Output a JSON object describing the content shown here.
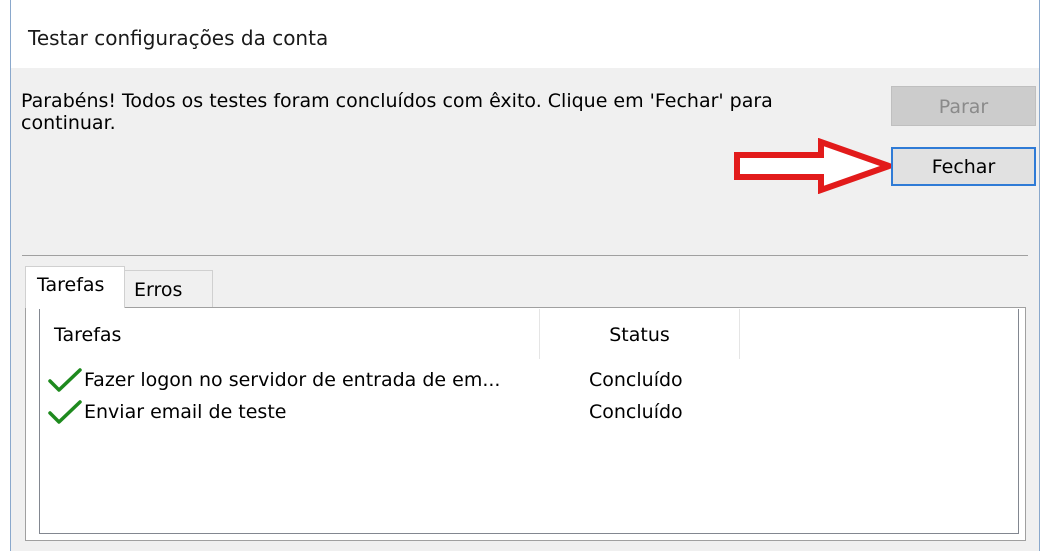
{
  "window": {
    "title": "Testar configurações da conta"
  },
  "message": "Parabéns! Todos os testes foram concluídos com êxito. Clique em 'Fechar' para continuar.",
  "buttons": {
    "stop_label": "Parar",
    "close_label": "Fechar"
  },
  "tabs": [
    {
      "label": "Tarefas",
      "selected": true
    },
    {
      "label": "Erros",
      "selected": false
    }
  ],
  "tasks_table": {
    "columns": [
      "Tarefas",
      "Status"
    ],
    "rows": [
      {
        "icon": "green-check-icon",
        "task": "Fazer logon no servidor de entrada de em...",
        "status": "Concluído"
      },
      {
        "icon": "green-check-icon",
        "task": "Enviar email de teste",
        "status": "Concluído"
      }
    ]
  },
  "colors": {
    "arrow": "#e21b1b",
    "check": "#1e8a1e",
    "focus_border": "#2f7bd6"
  }
}
